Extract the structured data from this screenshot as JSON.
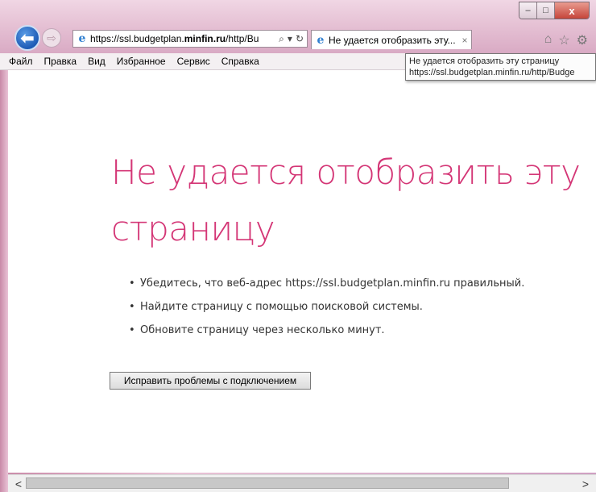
{
  "browser": {
    "address": {
      "url_prefix": "https://ssl.budgetplan.",
      "url_domain": "minfin.ru",
      "url_suffix": "/http/Bu"
    },
    "tab": {
      "title": "Не удается отобразить эту...",
      "close_glyph": "×"
    },
    "controls": {
      "minimize": "–",
      "maximize": "□",
      "close": "x"
    },
    "nav": {
      "back_glyph": "⬅",
      "forward_glyph": "⇨",
      "search_glyph": "⌕",
      "dropdown_glyph": "▾",
      "refresh_glyph": "↻"
    },
    "toolbar_icons": {
      "home": "⌂",
      "favorites": "☆",
      "settings": "⚙"
    },
    "menu": [
      "Файл",
      "Правка",
      "Вид",
      "Избранное",
      "Сервис",
      "Справка"
    ],
    "tooltip": {
      "line1": "Не удается отобразить эту страницу",
      "line2": "https://ssl.budgetplan.minfin.ru/http/Budge"
    }
  },
  "page": {
    "title_line1": "Не удается отобразить эту",
    "title_line2": "страницу",
    "tips": [
      "Убедитесь, что веб-адрес https://ssl.budgetplan.minfin.ru правильный.",
      "Найдите страницу с помощью поисковой системы.",
      "Обновите страницу через несколько минут."
    ],
    "fix_button": "Исправить проблемы с подключением",
    "accent_color": "#d43676"
  },
  "scrollbar": {
    "left_glyph": "<",
    "right_glyph": ">"
  }
}
